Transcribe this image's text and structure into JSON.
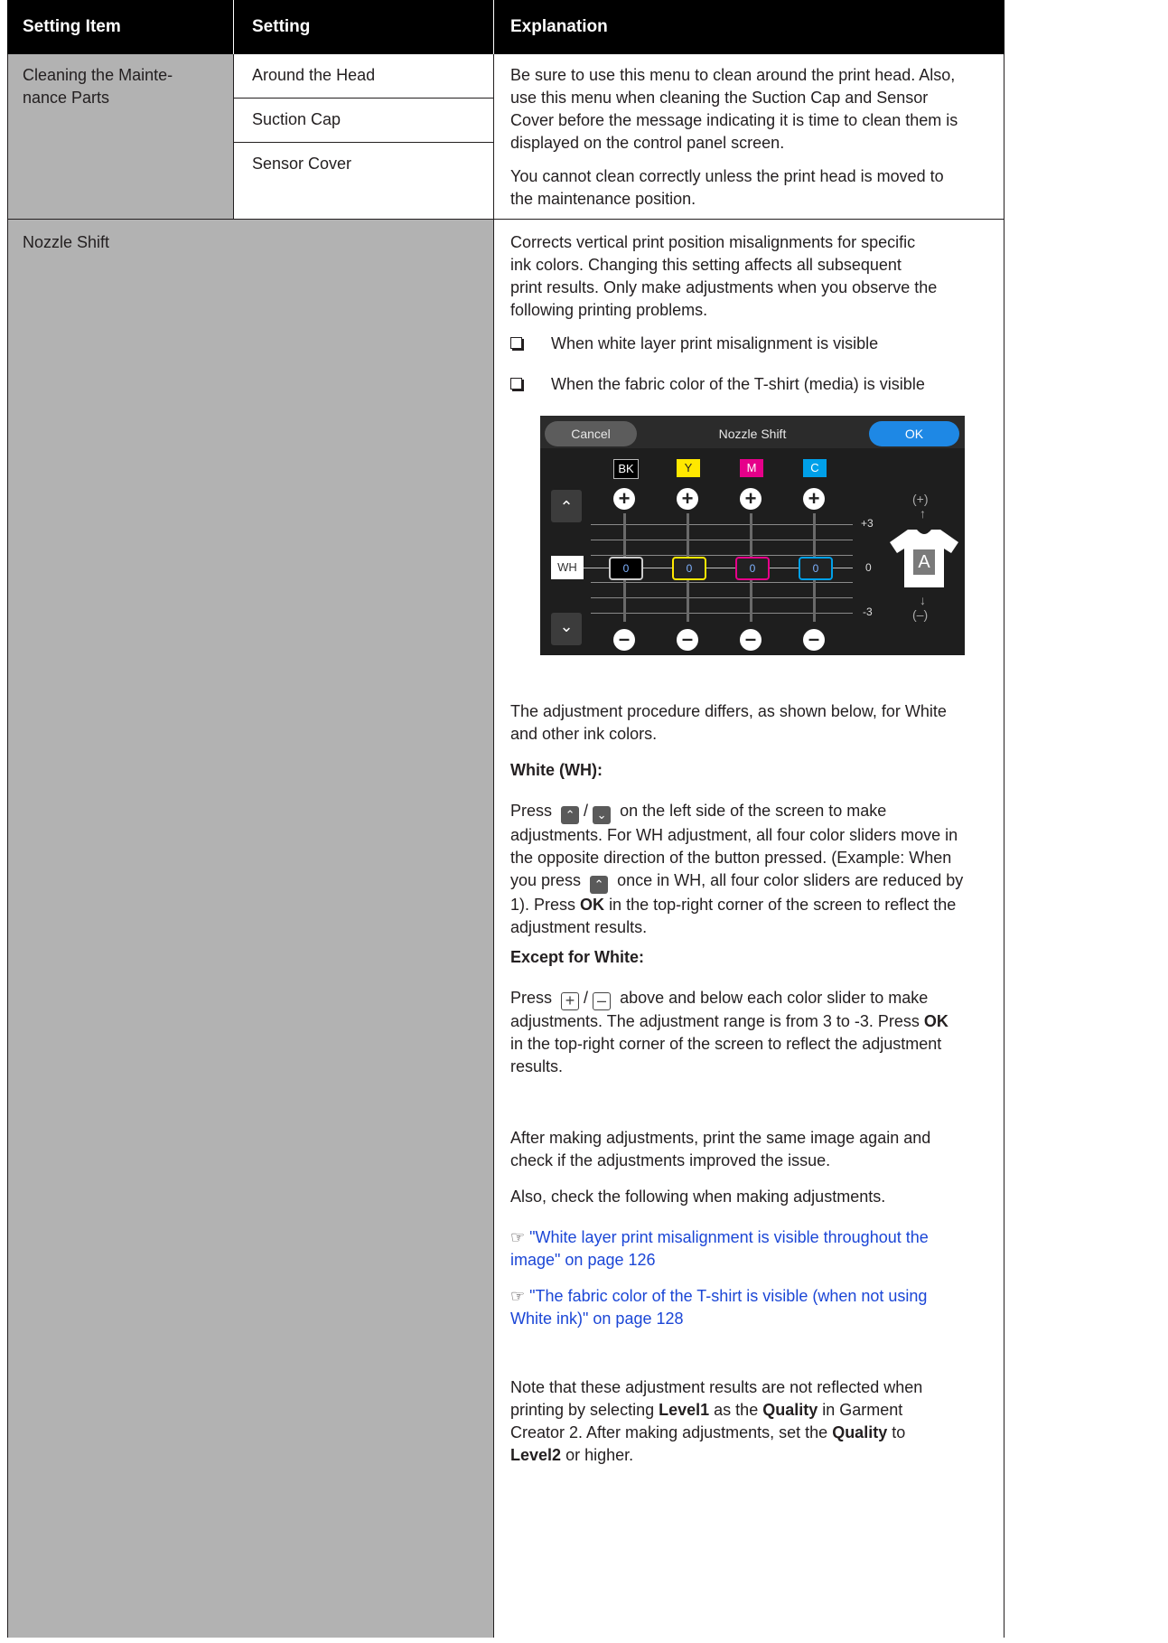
{
  "header": {
    "col1": "Setting Item",
    "col2": "Setting",
    "col3": "Explanation"
  },
  "row1": {
    "item": "Cleaning the Mainte-nance Parts",
    "item_line1": "Cleaning the Mainte-",
    "item_line2": "nance Parts",
    "settings": [
      "Around the Head",
      "Suction Cap",
      "Sensor Cover"
    ],
    "explanation_p1_lines": [
      "Be sure to use this menu to clean around the print head. Also,",
      "use this menu when cleaning the Suction Cap and Sensor",
      "Cover before the message indicating it is time to clean them is",
      "displayed on the control panel screen."
    ],
    "explanation_p2_lines": [
      "You cannot clean correctly unless the print head is moved to",
      "the maintenance position."
    ]
  },
  "row2": {
    "item": "Nozzle Shift",
    "intro_lines": [
      "Corrects vertical print position misalignments for specific",
      "ink colors. Changing this setting affects all subsequent",
      "print results. Only make adjustments when you observe the",
      "following printing problems."
    ],
    "bullets": [
      "When white layer print misalignment is visible",
      "When the fabric color of the T-shirt (media) is visible"
    ],
    "screen": {
      "cancel": "Cancel",
      "title": "Nozzle Shift",
      "ok": "OK",
      "colors": [
        {
          "label": "BK",
          "color": "#000000",
          "text_color": "#ffffff",
          "value": "0"
        },
        {
          "label": "Y",
          "color": "#ffe800",
          "text_color": "#000000",
          "value": "0"
        },
        {
          "label": "M",
          "color": "#e6008a",
          "text_color": "#ffffff",
          "value": "0"
        },
        {
          "label": "C",
          "color": "#00a0e9",
          "text_color": "#ffffff",
          "value": "0"
        }
      ],
      "wh": "WH",
      "scale_top": "+3",
      "scale_mid": "0",
      "scale_bottom": "-3",
      "plus_label": "(+)",
      "minus_label": "(–)",
      "shirt_letter": "A"
    },
    "procedure_lines": [
      "The adjustment procedure differs, as shown below, for White",
      "and other ink colors."
    ],
    "white_heading": "White (WH):",
    "white_lines": [
      "adjustments. For WH adjustment, all four color sliders move in",
      "the opposite direction of the button pressed. (Example: When"
    ],
    "white_press": "Press",
    "white_press_tail": "on the left side of the screen to make",
    "white_line4_a": "you press",
    "white_line4_b": "once in WH, all four color sliders are reduced by",
    "white_line5_a": "1). Press",
    "white_line5_ok": "OK",
    "white_line5_b": "in the top-right corner of the screen to reflect the",
    "white_line6": "adjustment results.",
    "except_heading": "Except for White:",
    "except_press": "Press",
    "except_press_tail": "above and below each color slider to make",
    "except_line2_a": "adjustments. The adjustment range is from 3 to -3. Press",
    "except_line2_ok": "OK",
    "except_line3": "in the top-right corner of the screen to reflect the adjustment",
    "except_line4": "results.",
    "after_lines": [
      "After making adjustments, print the same image again and",
      "check if the adjustments improved the issue."
    ],
    "also_line": "Also, check the following when making adjustments.",
    "link1_lines": [
      "\"White layer print misalignment is visible throughout the",
      "image\" on page 126"
    ],
    "link2_lines": [
      "\"The fabric color of the T-shirt is visible (when not using",
      "White ink)\" on page 128"
    ],
    "note_line1": "Note that these adjustment results are not reflected when",
    "note_line2_a": "printing by selecting",
    "note_line2_level1": "Level1",
    "note_line2_b": "as the",
    "note_line2_quality": "Quality",
    "note_line2_c": "in Garment",
    "note_line3_a": "Creator 2. After making adjustments, set the",
    "note_line3_quality": "Quality",
    "note_line3_b": "to",
    "note_line4_level2": "Level2",
    "note_line4_b": "or higher."
  }
}
